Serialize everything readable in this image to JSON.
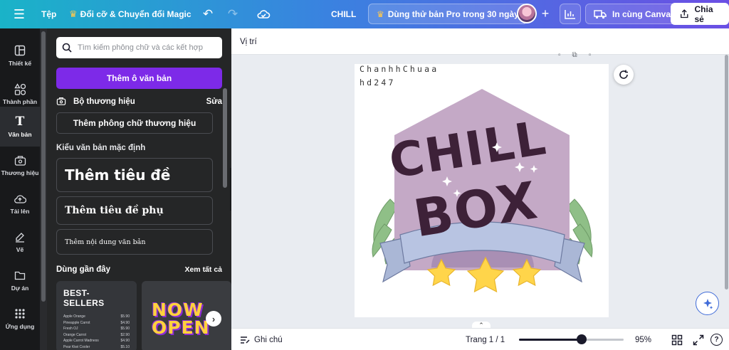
{
  "topbar": {
    "menu_icon": "hamburger-icon",
    "file_label": "Tệp",
    "magic_label": "Đổi cỡ & Chuyển đổi Magic",
    "doc_title": "CHILL",
    "pro_trial_label": "Dùng thử bản Pro trong 30 ngày",
    "print_label": "In cùng Canva",
    "share_label": "Chia sẻ",
    "accent_gradient": [
      "#1ab3c8",
      "#3a82e0",
      "#6b4fe4"
    ]
  },
  "rail": {
    "items": [
      {
        "label": "Thiết kế",
        "icon": "layout-icon"
      },
      {
        "label": "Thành phần",
        "icon": "shapes-icon"
      },
      {
        "label": "Văn bản",
        "icon": "text-icon",
        "active": true
      },
      {
        "label": "Thương hiệu",
        "icon": "brand-icon"
      },
      {
        "label": "Tải lên",
        "icon": "upload-icon"
      },
      {
        "label": "Vẽ",
        "icon": "draw-icon"
      },
      {
        "label": "Dự án",
        "icon": "folder-icon"
      },
      {
        "label": "Ứng dụng",
        "icon": "apps-icon"
      }
    ]
  },
  "panel": {
    "search_placeholder": "Tìm kiếm phông chữ và các kết hợp",
    "add_textbox_label": "Thêm ô văn bản",
    "brand_kit_label": "Bộ thương hiệu",
    "brand_kit_edit": "Sửa",
    "add_brand_fonts_label": "Thêm phông chữ thương hiệu",
    "default_styles_label": "Kiểu văn bản mặc định",
    "heading_label": "Thêm tiêu đề",
    "subheading_label": "Thêm tiêu đề phụ",
    "body_label": "Thêm nội dung văn bản",
    "recent_label": "Dùng gần đây",
    "see_all_label": "Xem tất cả",
    "recent_items": [
      {
        "title": "BEST-SELLERS",
        "lines": [
          [
            "Apple Orange",
            "$5.90"
          ],
          [
            "Pineapple Carrot",
            "$4.90"
          ],
          [
            "Fresh OJ",
            "$5.90"
          ],
          [
            "Orange Carrot",
            "$2.90"
          ],
          [
            "Apple Carrot Madness",
            "$4.90"
          ],
          [
            "Pear Kiwi Cooler",
            "$5.10"
          ]
        ]
      },
      {
        "title": "NOW OPEN"
      }
    ]
  },
  "editor": {
    "position_label": "Vị trí",
    "page_text_line1": "ChanhhChuaa",
    "page_text_line2": "hd247",
    "design": {
      "word1": "CHILL",
      "word2": "BOX"
    }
  },
  "bottom": {
    "notes_label": "Ghi chú",
    "pages_label": "Trang 1 / 1",
    "zoom_label": "95%",
    "zoom_fraction": 0.6
  }
}
